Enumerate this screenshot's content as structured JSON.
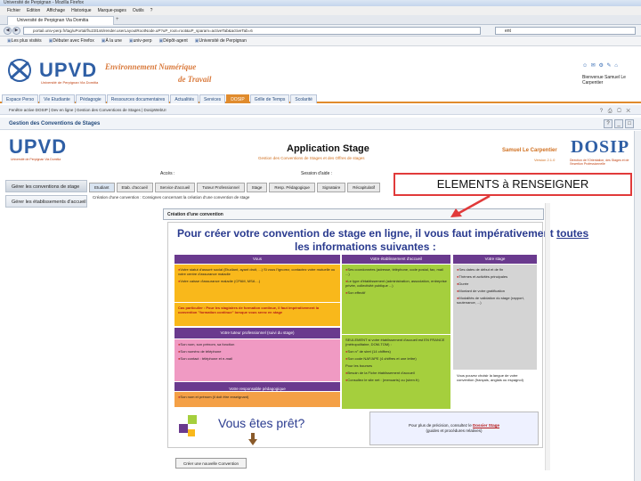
{
  "window": {
    "title": "Université de Perpignan - Mozilla Firefox"
  },
  "menu": [
    "Fichier",
    "Edition",
    "Affichage",
    "Historique",
    "Marque-pages",
    "Outils",
    "?"
  ],
  "browser": {
    "tab_label": "Université de Perpignan Via Domitia",
    "new_tab": "+",
    "url": "portail.univ-perp.fr/tag/uPortal/f/u23l1s6/render.userLayoutRootNode.uP?uP_root=root&uP_sparam=activeTab&activeTab=6",
    "search_value": "ent",
    "back": "◀",
    "forward": "▶"
  },
  "bookmarks": [
    "Les plus visités",
    "Débuter avec Firefox",
    "À la une",
    "univ-perp",
    "Dépôt-agent",
    "Université de Perpignan"
  ],
  "ent": {
    "logo_text": "UPVD",
    "logo_sub": "Université de Perpignan Via Domitia",
    "title_line1": "Environnement Numérique",
    "title_line2": "de Travail",
    "icons": "☺ ✉ ⚙ ✎ ⌂",
    "welcome": "Bienvenue Samuel Le Carpentier",
    "tabs": [
      "Espace Perso",
      "Vie Etudiante",
      "Pédagogie",
      "Ressources documentaires",
      "Actualités",
      "Services",
      "DOSIP",
      "Grille de Temps",
      "Scolarité"
    ],
    "active_tab": "DOSIP"
  },
  "crumb": {
    "text": "Fenêtre active DOSIP | Dev en ligne | Gestion des Conventions de Stages | DosipWebUI",
    "icons": "? ⎙ ▢ ✕"
  },
  "module": {
    "title": "Gestion des Conventions de Stages",
    "btns": [
      "?",
      "_",
      "□"
    ]
  },
  "app": {
    "upvd": "UPVD",
    "upvd_sub": "Université de Perpignan Via Domitia",
    "title": "Application Stage",
    "subtitle": "Gestion des Conventions de Stages et des Offres de stages",
    "user": "Samuel Le Carpentier",
    "version": "Version 2.1.0",
    "dosip": "DOSIP",
    "dosip_sub": "Direction de l'Orientation, des Stages et de l'Insertion Professionnelle",
    "role_acces": "Accès :",
    "role_session": "Session d'aide :"
  },
  "left_menu": [
    "Gérer les conventions de stage",
    "Gérer les établissements d'accueil"
  ],
  "app_tabs": [
    "Etudiant",
    "Etab. d'accueil",
    "Service d'accueil",
    "Tuteur Professionnel",
    "Stage",
    "Resp. Pédagogique",
    "Signataire",
    "Récapitulatif"
  ],
  "content": {
    "info": "Création d'une convention : Consignes concernant la création d'une convention de stage",
    "frame_title": "Création d'une convention"
  },
  "panel": {
    "heading1_prefix": "Pour créer votre convention de stage en ligne, il vous faut impérativement ",
    "heading1_underlined": "toutes",
    "heading2": "les informations suivantes :",
    "col_vous": "Vous",
    "col_accueil": "Votre établissement d'accueil",
    "col_stage": "Votre stage",
    "vous_items": [
      "Votre statut d'assuré social (Etudiant, ayant droit, ...) Si vous l'ignorez, contactez votre mutuelle ou votre centre d'assurance maladie",
      "Votre caisse d'assurance maladie (CPAM, MSA ...)"
    ],
    "partic": "Cas particulier : Pour les stagiaires de formation continue, il faut impérativement la convention \"formation continue\" lorsque vous serez en stage",
    "tuteur_head": "Votre tuteur professionnel (suivi du stage)",
    "tuteur_items": [
      "Son nom, son prénom, sa fonction",
      "Son numéro de téléphone",
      "Son contact : téléphone et e-mail"
    ],
    "peda_head": "Votre responsable pédagogique",
    "peda_items": [
      "Son nom et prénom (il doit être enseignant)"
    ],
    "accueil_items": [
      "Ses coordonnées (adresse, téléphone, code postal, fax, mail ...)",
      "Le type d'établissement (administration, association, entreprise privée, collectivité publique ...)",
      "Son effectif"
    ],
    "accueil2_intro": "SEULEMENT si votre établissement d'accueil est EN FRANCE (métropolitaine, DOM-TOM) :",
    "accueil2_items": [
      "Son n° de siret (14 chiffres)",
      "Son code NAF/APE (4 chiffres et une lettre)"
    ],
    "accueil2_extra": [
      "Pour les bourses",
      "Besoin de la Fiche établissement d'accueil",
      "Consultez le site net : (menuarts) ou (siren.fr)"
    ],
    "stage_items": [
      "Ses dates de début et de fin",
      "Thèmes et activités principales",
      "Durée",
      "Montant de votre gratification",
      "Modalités de validation du stage (rapport, soutenance, ...)"
    ],
    "stage_extra": "Vous pouvez choisir la langue de votre convention (français, anglais ou espagnol)",
    "ready": "Vous êtes prêt?",
    "annuaire_prefix": "Pour plus de précision, consultez le ",
    "annuaire_link": "Dossier Stage",
    "annuaire_suffix": "(guides et procédures relatives)"
  },
  "new_convention_button": "Créer une nouvelle Convention",
  "annotation": {
    "text": "ELEMENTS à RENSEIGNER"
  },
  "colors": {
    "accent": "#e08b2d",
    "heading": "#2a3b8f",
    "annotation": "#e13a3a"
  }
}
